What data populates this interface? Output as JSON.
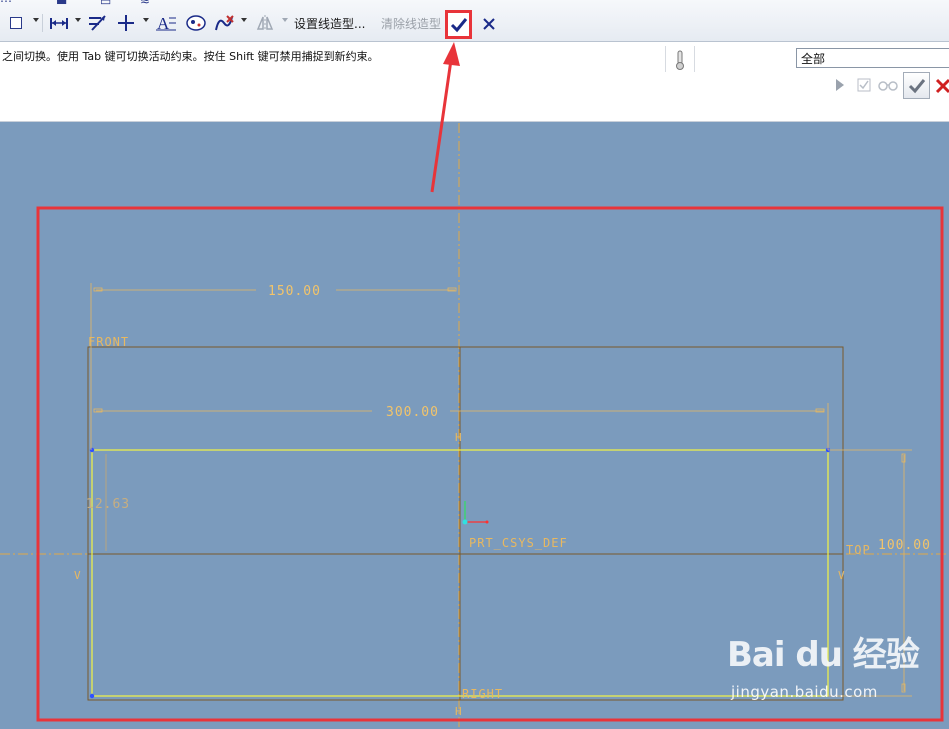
{
  "toolbar": {
    "set_linestyle": "设置线造型...",
    "clear_linestyle": "清除线造型"
  },
  "message": {
    "text": "之间切换。使用 Tab 键可切换活动约束。按住 Shift 键可禁用捕捉到新约束。",
    "filter_value": "全部"
  },
  "sketch": {
    "dim_150": "150.00",
    "dim_300": "300.00",
    "dim_100": "100.00",
    "dim_left": "12.63",
    "label_front": "FRONT",
    "label_top": "TOP",
    "label_right": "RIGHT",
    "label_csys": "PRT_CSYS_DEF",
    "axis_h": "H",
    "axis_v": "V"
  },
  "watermark": {
    "brand": "Bai du 经验",
    "url": "jingyan.baidu.com"
  },
  "colors": {
    "background": "#7b9bbd",
    "sketch_line": "#f5f542",
    "dimension": "#f2c46a",
    "datum": "#7a5a2a",
    "highlight": "#e8343a"
  }
}
